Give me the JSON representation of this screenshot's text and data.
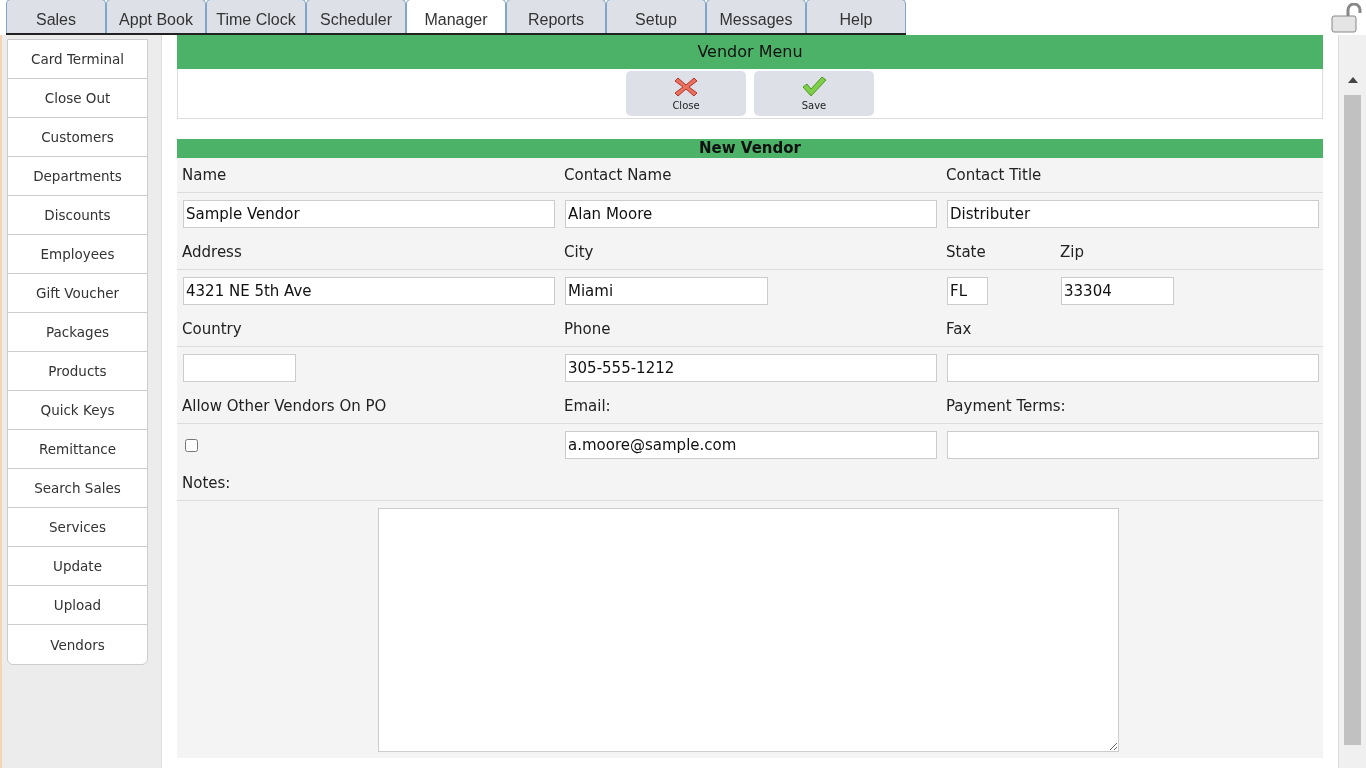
{
  "tabs": [
    {
      "label": "Sales",
      "selected": false
    },
    {
      "label": "Appt Book",
      "selected": false
    },
    {
      "label": "Time Clock",
      "selected": false
    },
    {
      "label": "Scheduler",
      "selected": false
    },
    {
      "label": "Manager",
      "selected": true
    },
    {
      "label": "Reports",
      "selected": false
    },
    {
      "label": "Setup",
      "selected": false
    },
    {
      "label": "Messages",
      "selected": false
    },
    {
      "label": "Help",
      "selected": false
    }
  ],
  "sidebar": {
    "items": [
      {
        "label": "Card Terminal"
      },
      {
        "label": "Close Out"
      },
      {
        "label": "Customers"
      },
      {
        "label": "Departments"
      },
      {
        "label": "Discounts"
      },
      {
        "label": "Employees"
      },
      {
        "label": "Gift Voucher"
      },
      {
        "label": "Packages"
      },
      {
        "label": "Products"
      },
      {
        "label": "Quick Keys"
      },
      {
        "label": "Remittance"
      },
      {
        "label": "Search Sales"
      },
      {
        "label": "Services"
      },
      {
        "label": "Update"
      },
      {
        "label": "Upload"
      },
      {
        "label": "Vendors"
      }
    ]
  },
  "vendor_menu": {
    "title": "Vendor Menu",
    "buttons": [
      {
        "label": "Close",
        "kind": "close"
      },
      {
        "label": "Save",
        "kind": "save"
      }
    ]
  },
  "form": {
    "title": "New Vendor",
    "rows": [
      {
        "cells": [
          {
            "fields": [
              {
                "label": "Name",
                "kind": "wide",
                "value": "Sample Vendor"
              }
            ]
          },
          {
            "fields": [
              {
                "label": "Contact Name",
                "kind": "wide",
                "value": "Alan Moore"
              }
            ]
          },
          {
            "fields": [
              {
                "label": "Contact Title",
                "kind": "wide",
                "value": "Distributer"
              }
            ]
          }
        ]
      },
      {
        "cells": [
          {
            "fields": [
              {
                "label": "Address",
                "kind": "wide",
                "value": "4321 NE 5th Ave"
              }
            ]
          },
          {
            "fields": [
              {
                "label": "City",
                "kind": "medium",
                "value": "Miami"
              }
            ]
          },
          {
            "fields": [
              {
                "label": "State",
                "kind": "tiny",
                "value": "FL"
              },
              {
                "label": "Zip",
                "kind": "short",
                "value": "33304"
              }
            ]
          }
        ]
      },
      {
        "cells": [
          {
            "fields": [
              {
                "label": "Country",
                "kind": "short"
              }
            ]
          },
          {
            "fields": [
              {
                "label": "Phone",
                "kind": "wide",
                "value": "305-555-1212"
              }
            ]
          },
          {
            "fields": [
              {
                "label": "Fax",
                "kind": "wide"
              }
            ]
          }
        ]
      },
      {
        "cells": [
          {
            "fields": [
              {
                "label": "Allow Other Vendors On PO",
                "kind": "checkbox",
                "checked": false
              }
            ]
          },
          {
            "fields": [
              {
                "label": "Email:",
                "kind": "wide",
                "value": "a.moore@sample.com"
              }
            ]
          },
          {
            "fields": [
              {
                "label": "Payment Terms:",
                "kind": "wide"
              }
            ]
          }
        ]
      }
    ],
    "notes": {
      "label": "Notes:"
    }
  }
}
